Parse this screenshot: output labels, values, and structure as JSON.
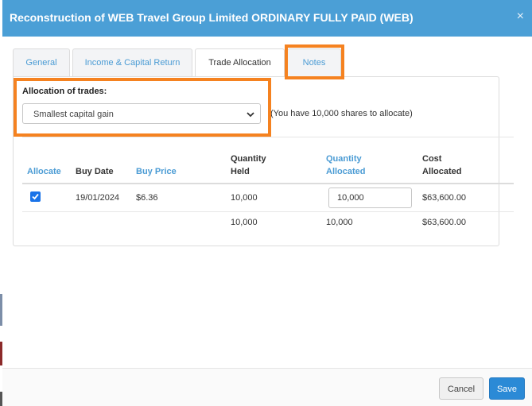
{
  "dialog": {
    "title": "Reconstruction of WEB Travel Group Limited ORDINARY FULLY PAID (WEB)",
    "close_label": "×"
  },
  "tabs": [
    {
      "label": "General",
      "active": false
    },
    {
      "label": "Income & Capital Return",
      "active": false
    },
    {
      "label": "Trade Allocation",
      "active": true
    },
    {
      "label": "Notes",
      "active": false
    }
  ],
  "allocation": {
    "label": "Allocation of trades:",
    "selected": "Smallest capital gain",
    "note": "(You have 10,000 shares to allocate)"
  },
  "table": {
    "headers": {
      "allocate": "Allocate",
      "buy_date": "Buy Date",
      "buy_price": "Buy Price",
      "quantity_held_1": "Quantity",
      "quantity_held_2": "Held",
      "quantity_allocated_1": "Quantity",
      "quantity_allocated_2": "Allocated",
      "cost_allocated_1": "Cost",
      "cost_allocated_2": "Allocated"
    },
    "rows": [
      {
        "checked": true,
        "buy_date": "19/01/2024",
        "buy_price": "$6.36",
        "quantity_held": "10,000",
        "quantity_allocated": "10,000",
        "cost_allocated": "$63,600.00"
      }
    ],
    "totals": {
      "quantity_held": "10,000",
      "quantity_allocated": "10,000",
      "cost_allocated": "$63,600.00"
    }
  },
  "footer": {
    "cancel_label": "Cancel",
    "save_label": "Save"
  },
  "colors": {
    "header": "#4b9fd6",
    "accent": "#4a9bd4",
    "highlight": "#f58220",
    "save": "#2b8ad6"
  }
}
